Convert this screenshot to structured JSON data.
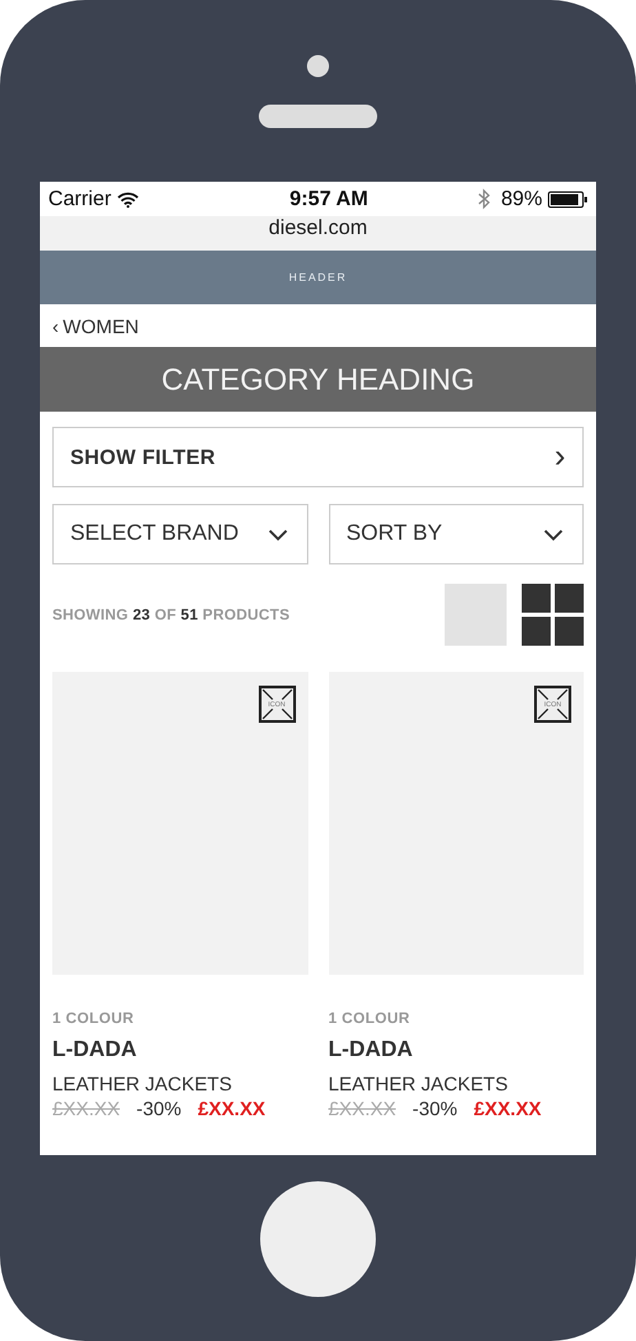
{
  "status_bar": {
    "carrier": "Carrier",
    "time": "9:57 AM",
    "battery": "89%"
  },
  "browser": {
    "url": "diesel.com"
  },
  "header": {
    "label": "HEADER"
  },
  "breadcrumb": {
    "chevron": "‹",
    "label": "WOMEN"
  },
  "category_heading": "CATEGORY HEADING",
  "filter_button": {
    "label": "SHOW FILTER",
    "chevron": "›"
  },
  "dropdowns": [
    {
      "label": "SELECT BRAND"
    },
    {
      "label": "SORT BY"
    }
  ],
  "results": {
    "text": "SHOWING **23** OF **51** PRODUCTS"
  },
  "view_options": [
    {
      "kind": "single",
      "selected": false
    },
    {
      "kind": "grid",
      "selected": true
    }
  ],
  "products": [
    {
      "icon_label": "ICON",
      "colours": "1 COLOUR",
      "name": "L-DADA",
      "category": "LEATHER JACKETS",
      "old_price": "£XX.XX",
      "discount": "-30%",
      "price": "£XX.XX"
    },
    {
      "icon_label": "ICON",
      "colours": "1 COLOUR",
      "name": "L-DADA",
      "category": "LEATHER JACKETS",
      "old_price": "£XX.XX",
      "discount": "-30%",
      "price": "£XX.XX"
    }
  ]
}
